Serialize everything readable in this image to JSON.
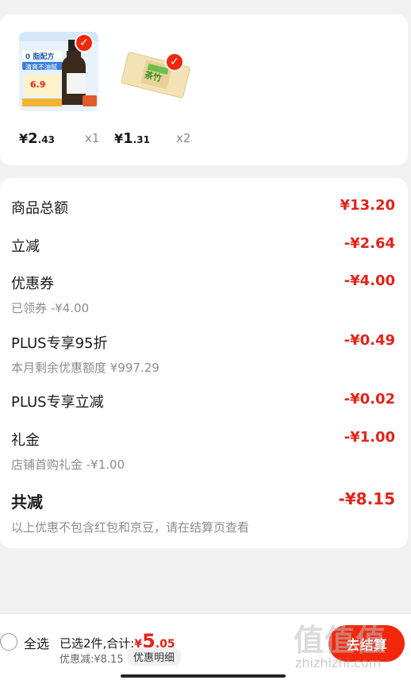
{
  "products": [
    {
      "image": "product-oil-bottle",
      "price_yen": "¥",
      "price_int": "2",
      "price_dec": ".43",
      "qty": "x1",
      "checked": true
    },
    {
      "image": "product-tea-pack",
      "price_yen": "¥",
      "price_int": "1",
      "price_dec": ".31",
      "qty": "x2",
      "checked": true
    }
  ],
  "product_image_text": {
    "oil_title": "0 脂配方",
    "oil_sub": "清爽不油腻",
    "oil_price": "6.9",
    "tea_label": "茶竹"
  },
  "summary": {
    "goods_total": {
      "label": "商品总额",
      "value": "¥13.20"
    },
    "instant_cut": {
      "label": "立减",
      "value": "-¥2.64"
    },
    "coupon": {
      "label": "优惠券",
      "value": "-¥4.00",
      "sub": "已领券 -¥4.00"
    },
    "plus95": {
      "label": "PLUS专享95折",
      "value": "-¥0.49",
      "sub": "本月剩余优惠额度 ¥997.29"
    },
    "plus_cut": {
      "label": "PLUS专享立减",
      "value": "-¥0.02"
    },
    "gift": {
      "label": "礼金",
      "value": "-¥1.00",
      "sub": "店铺首购礼金 -¥1.00"
    },
    "total": {
      "label": "共减",
      "value": "-¥8.15",
      "sub": "以上优惠不包含红包和京豆，请在结算页查看"
    }
  },
  "bottom_bar": {
    "select_all": "全选",
    "selected": "已选2件,合计:",
    "price_yen": "¥",
    "price_int": "5",
    "price_dec": ".05",
    "discount": "优惠减:¥8.15",
    "detail_button": "优惠明细",
    "checkout_button": "去结算"
  },
  "watermark": {
    "logo": "值值值",
    "url": "zhizhizhi.com"
  },
  "colors": {
    "accent": "#e2231a",
    "check": "#f2270c"
  }
}
